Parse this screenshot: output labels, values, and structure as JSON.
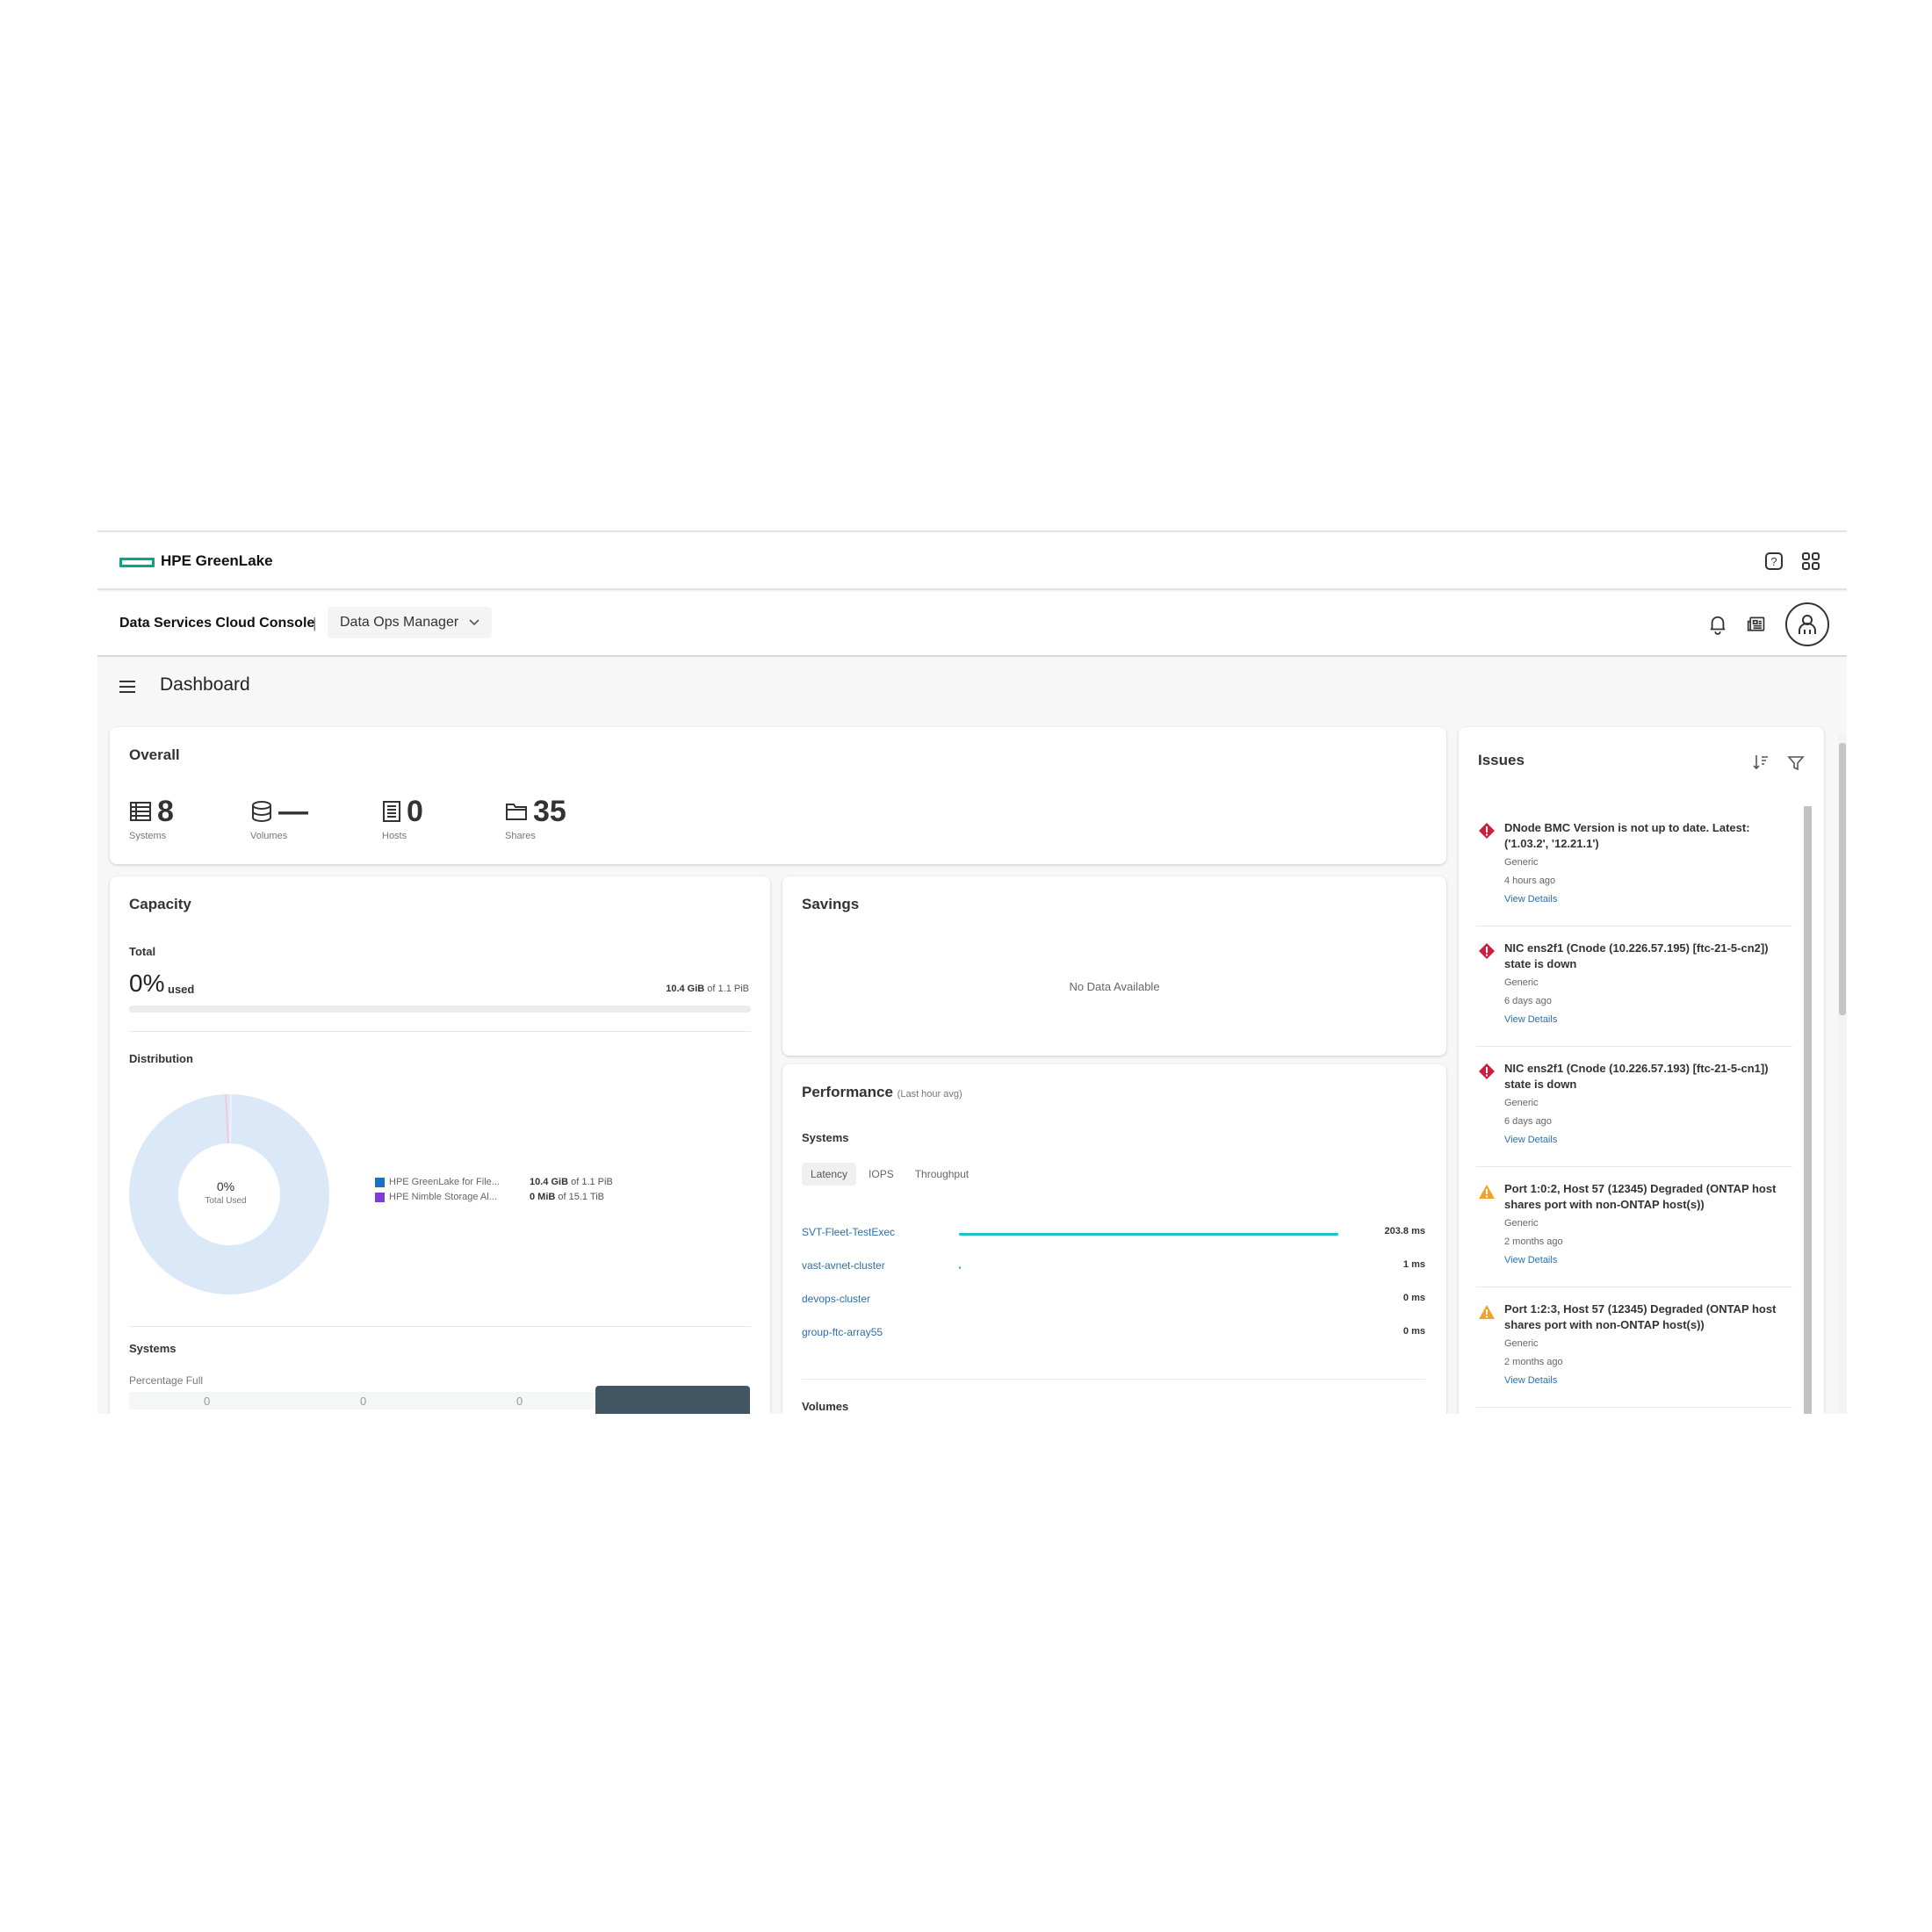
{
  "topbar": {
    "brand": "HPE GreenLake"
  },
  "console": {
    "title": "Data Services Cloud Console",
    "separator": "|",
    "app": "Data Ops Manager"
  },
  "page": {
    "title": "Dashboard"
  },
  "overall": {
    "title": "Overall",
    "stats": [
      {
        "icon": "systems-icon",
        "value": "8",
        "label": "Systems"
      },
      {
        "icon": "volumes-icon",
        "value": "—",
        "label": "Volumes"
      },
      {
        "icon": "hosts-icon",
        "value": "0",
        "label": "Hosts"
      },
      {
        "icon": "shares-icon",
        "value": "35",
        "label": "Shares"
      }
    ]
  },
  "capacity": {
    "title": "Capacity",
    "total_label": "Total",
    "used_pct": "0%",
    "used_word": "used",
    "used_value": "10.4 GiB",
    "of_text": "of 1.1 PiB",
    "used_fraction": 0.0,
    "distribution_label": "Distribution",
    "donut_center": "0%",
    "donut_sub": "Total Used",
    "legend": [
      {
        "name": "HPE GreenLake for File...",
        "color": "#1a6fc9",
        "value": "10.4 GiB",
        "of": "of 1.1 PiB"
      },
      {
        "name": "HPE Nimble Storage Al...",
        "color": "#7d3cd8",
        "value": "0 MiB",
        "of": "of 15.1 TiB"
      }
    ],
    "systems_label": "Systems",
    "percentage_label": "Percentage Full",
    "bar_values": [
      "0",
      "0",
      "0"
    ]
  },
  "savings": {
    "title": "Savings",
    "empty": "No Data Available"
  },
  "performance": {
    "title": "Performance",
    "subtitle": "(Last hour avg)",
    "systems_label": "Systems",
    "tabs": [
      "Latency",
      "IOPS",
      "Throughput"
    ],
    "rows": [
      {
        "name": "SVT-Fleet-TestExec",
        "value": "203.8 ms",
        "fraction": 1.0
      },
      {
        "name": "vast-avnet-cluster",
        "value": "1 ms",
        "fraction": 0.005
      },
      {
        "name": "devops-cluster",
        "value": "0 ms",
        "fraction": 0
      },
      {
        "name": "group-ftc-array55",
        "value": "0 ms",
        "fraction": 0
      }
    ],
    "volumes_label": "Volumes"
  },
  "issues": {
    "title": "Issues",
    "items": [
      {
        "severity": "critical",
        "title": "DNode BMC Version is not up to date. Latest: ('1.03.2', '12.21.1')",
        "category": "Generic",
        "time": "4 hours ago",
        "link": "View Details"
      },
      {
        "severity": "critical",
        "title": "NIC ens2f1 (Cnode (10.226.57.195) [ftc-21-5-cn2]) state is down",
        "category": "Generic",
        "time": "6 days ago",
        "link": "View Details"
      },
      {
        "severity": "critical",
        "title": "NIC ens2f1 (Cnode (10.226.57.193) [ftc-21-5-cn1]) state is down",
        "category": "Generic",
        "time": "6 days ago",
        "link": "View Details"
      },
      {
        "severity": "warning",
        "title": "Port 1:0:2, Host 57 (12345) Degraded (ONTAP host shares port with non-ONTAP host(s))",
        "category": "Generic",
        "time": "2 months ago",
        "link": "View Details"
      },
      {
        "severity": "warning",
        "title": "Port 1:2:3, Host 57 (12345) Degraded (ONTAP host shares port with non-ONTAP host(s))",
        "category": "Generic",
        "time": "2 months ago",
        "link": "View Details"
      }
    ]
  },
  "colors": {
    "brand": "#01a982",
    "critical": "#cc1f3f",
    "warning": "#f0a22a",
    "link": "#2a6fb0",
    "latency": "#1fc3c3",
    "donut": "#dbe8f8"
  }
}
